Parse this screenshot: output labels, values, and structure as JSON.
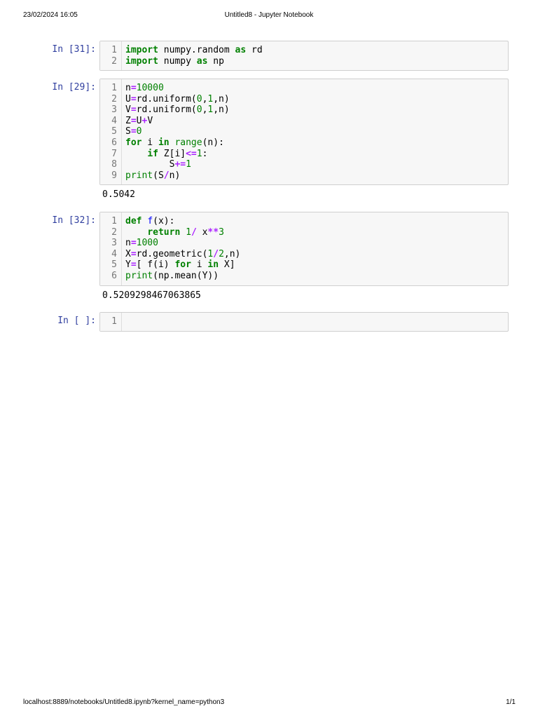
{
  "header": {
    "datetime": "23/02/2024 16:05",
    "title": "Untitled8 - Jupyter Notebook"
  },
  "footer": {
    "url": "localhost:8889/notebooks/Untitled8.ipynb?kernel_name=python3",
    "page": "1/1"
  },
  "cells": [
    {
      "prompt": "In [31]:",
      "lines": [
        [
          [
            "import",
            "k"
          ],
          [
            " numpy.random ",
            ""
          ],
          [
            "as",
            "k"
          ],
          [
            " rd",
            ""
          ]
        ],
        [
          [
            "import",
            "k"
          ],
          [
            " numpy ",
            ""
          ],
          [
            "as",
            "k"
          ],
          [
            " np",
            ""
          ]
        ]
      ],
      "output": null
    },
    {
      "prompt": "In [29]:",
      "lines": [
        [
          [
            "n",
            ""
          ],
          [
            "=",
            "o"
          ],
          [
            "10000",
            "n"
          ]
        ],
        [
          [
            "U",
            ""
          ],
          [
            "=",
            "o"
          ],
          [
            "rd.uniform(",
            ""
          ],
          [
            "0",
            "n"
          ],
          [
            ",",
            ""
          ],
          [
            "1",
            "n"
          ],
          [
            ",n)",
            ""
          ]
        ],
        [
          [
            "V",
            ""
          ],
          [
            "=",
            "o"
          ],
          [
            "rd.uniform(",
            ""
          ],
          [
            "0",
            "n"
          ],
          [
            ",",
            ""
          ],
          [
            "1",
            "n"
          ],
          [
            ",n)",
            ""
          ]
        ],
        [
          [
            "Z",
            ""
          ],
          [
            "=",
            "o"
          ],
          [
            "U",
            ""
          ],
          [
            "+",
            "o"
          ],
          [
            "V",
            ""
          ]
        ],
        [
          [
            "S",
            ""
          ],
          [
            "=",
            "o"
          ],
          [
            "0",
            "n"
          ]
        ],
        [
          [
            "for",
            "k"
          ],
          [
            " i ",
            ""
          ],
          [
            "in",
            "k"
          ],
          [
            " ",
            ""
          ],
          [
            "range",
            "b"
          ],
          [
            "(n):",
            ""
          ]
        ],
        [
          [
            "    ",
            ""
          ],
          [
            "if",
            "k"
          ],
          [
            " Z[i]",
            ""
          ],
          [
            "<=",
            "o"
          ],
          [
            "1",
            "n"
          ],
          [
            ":",
            ""
          ]
        ],
        [
          [
            "        S",
            ""
          ],
          [
            "+=",
            "o"
          ],
          [
            "1",
            "n"
          ]
        ],
        [
          [
            "print",
            "b"
          ],
          [
            "(S",
            ""
          ],
          [
            "/",
            "o"
          ],
          [
            "n)",
            ""
          ]
        ]
      ],
      "output": "0.5042"
    },
    {
      "prompt": "In [32]:",
      "lines": [
        [
          [
            "def",
            "k"
          ],
          [
            " ",
            ""
          ],
          [
            "f",
            "f"
          ],
          [
            "(x):",
            ""
          ]
        ],
        [
          [
            "    ",
            ""
          ],
          [
            "return",
            "k"
          ],
          [
            " ",
            ""
          ],
          [
            "1",
            "n"
          ],
          [
            "/",
            "o"
          ],
          [
            " x",
            ""
          ],
          [
            "**",
            "o"
          ],
          [
            "3",
            "n"
          ]
        ],
        [
          [
            "n",
            ""
          ],
          [
            "=",
            "o"
          ],
          [
            "1000",
            "n"
          ]
        ],
        [
          [
            "X",
            ""
          ],
          [
            "=",
            "o"
          ],
          [
            "rd.geometric(",
            ""
          ],
          [
            "1",
            "n"
          ],
          [
            "/",
            "o"
          ],
          [
            "2",
            "n"
          ],
          [
            ",n)",
            ""
          ]
        ],
        [
          [
            "Y",
            ""
          ],
          [
            "=",
            "o"
          ],
          [
            "[ f(i) ",
            ""
          ],
          [
            "for",
            "k"
          ],
          [
            " i ",
            ""
          ],
          [
            "in",
            "k"
          ],
          [
            " X]",
            ""
          ]
        ],
        [
          [
            "print",
            "b"
          ],
          [
            "(np.mean(Y))",
            ""
          ]
        ]
      ],
      "output": "0.5209298467063865"
    },
    {
      "prompt": "In [ ]:",
      "lines": [
        []
      ],
      "output": null
    }
  ]
}
